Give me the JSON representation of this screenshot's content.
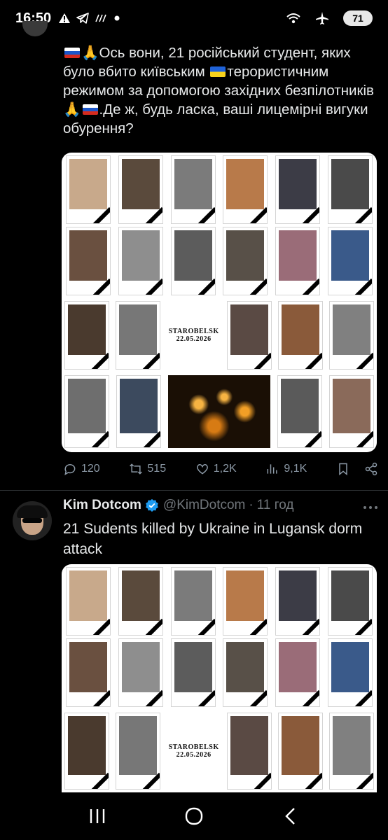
{
  "status_bar": {
    "time": "16:50",
    "battery": "71",
    "icons": [
      "warning-icon",
      "telegram-icon",
      "news-icon",
      "dot-icon",
      "wifi-icon",
      "airplane-icon",
      "battery-icon"
    ]
  },
  "tweet1": {
    "text": "Ось вони, 21 російський студент, яких було вбито київським ",
    "text_after_flag": "терористичним режимом за допомогою західних безпілотників",
    "text_end": ".Де ж, будь ласка, ваші лицемірні вигуки обурення?",
    "media": {
      "title_card_line1": "STAROBELSK",
      "title_card_line2": "22.05.2026"
    },
    "stats": {
      "replies": "120",
      "reposts": "515",
      "likes": "1,2K",
      "views": "9,1K"
    }
  },
  "tweet2": {
    "author_name": "Kim Dotcom",
    "handle": "@KimDotcom",
    "time": "11 год",
    "text": "21 Sudents killed by Ukraine in Lugansk dorm attack",
    "media": {
      "title_card_line1": "STAROBELSK",
      "title_card_line2": "22.05.2026"
    }
  },
  "colors": {
    "background": "#000000",
    "text": "#e7e9ea",
    "muted": "#71767b",
    "verified": "#1d9bf0"
  }
}
